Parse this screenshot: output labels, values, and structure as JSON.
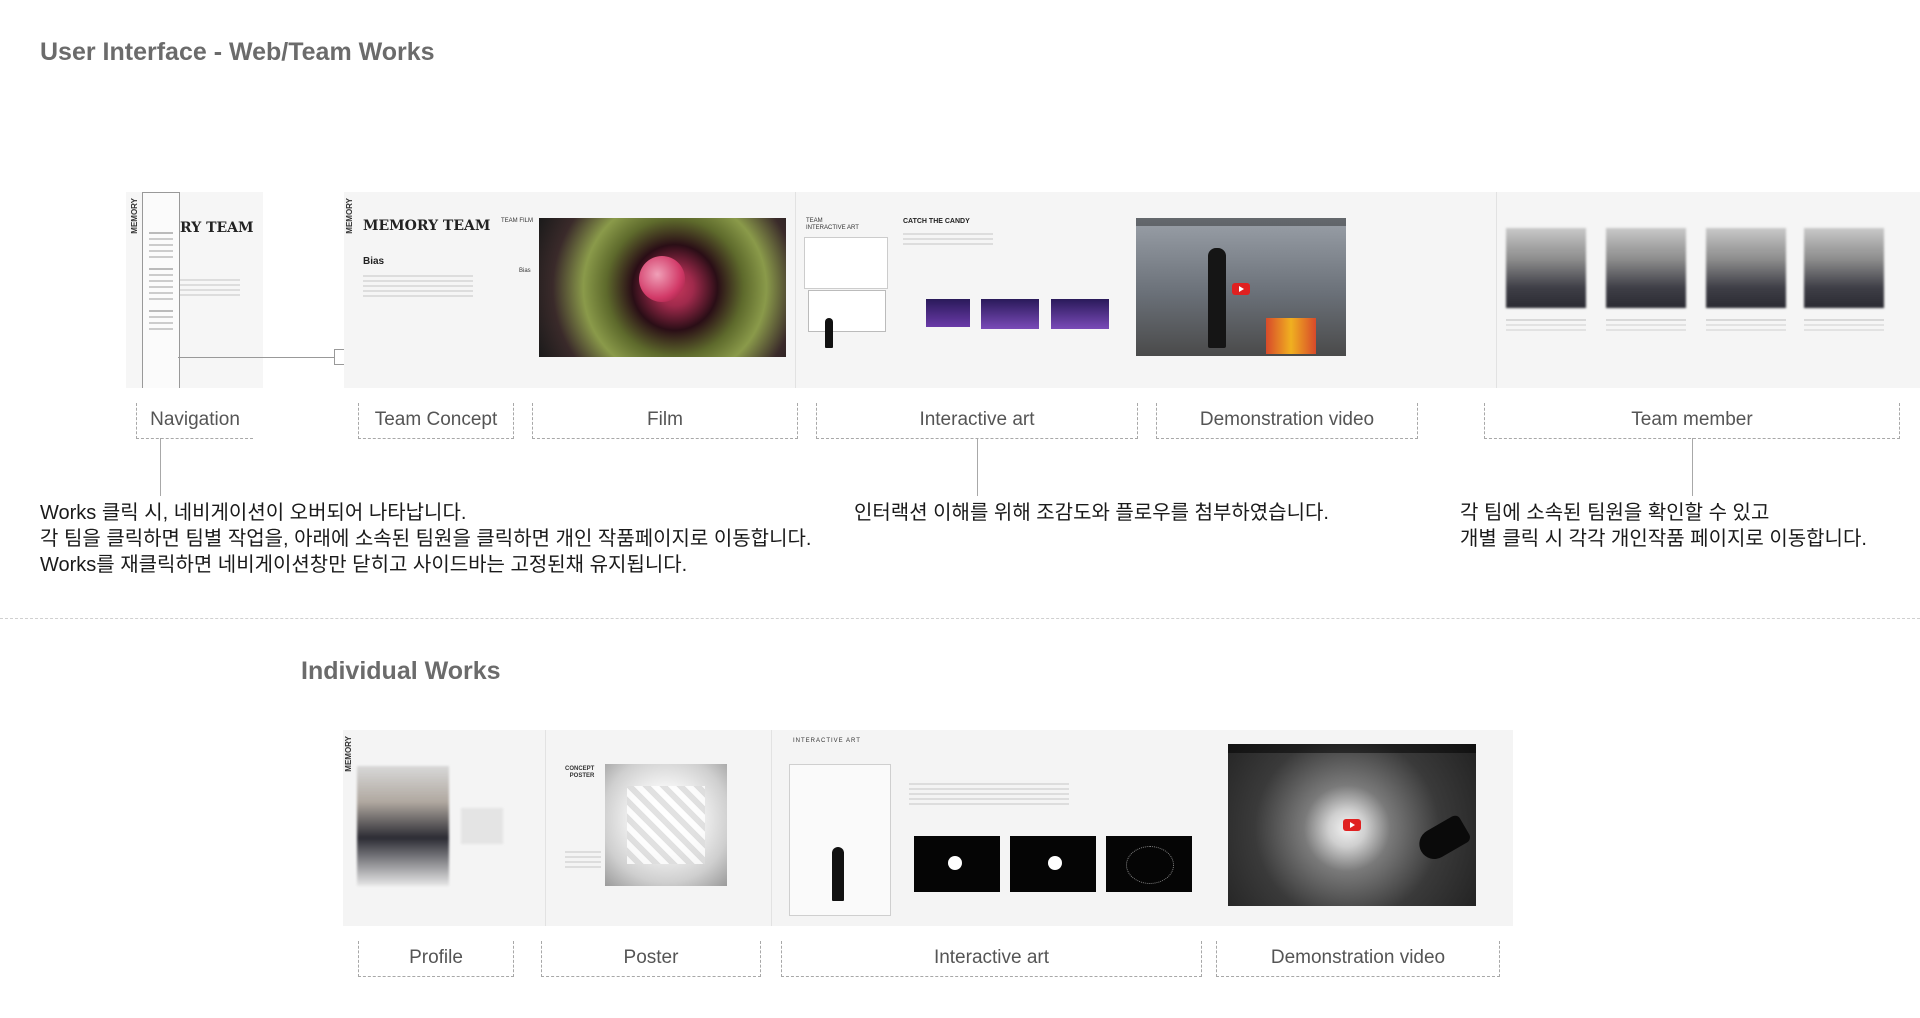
{
  "headings": {
    "team": "User Interface - Web/Team Works",
    "individual": "Individual Works"
  },
  "team_panels": {
    "team_name": "MEMORY TEAM",
    "team_name_partial": "RY TEAM",
    "team_film_label": "TEAM FILM",
    "film_title": "Bias",
    "film_title_small": "Bias",
    "interactive_label": "TEAM\nINTERACTIVE ART",
    "catch_title": "CATCH THE CANDY",
    "demo_video_label": "YouTube"
  },
  "team_captions": {
    "navigation": "Navigation",
    "team_concept": "Team Concept",
    "film": "Film",
    "interactive_art": "Interactive art",
    "demonstration_video": "Demonstration video",
    "team_member": "Team member"
  },
  "descriptions": {
    "navigation": [
      "Works 클릭 시, 네비게이션이 오버되어 나타납니다.",
      "각 팀을 클릭하면 팀별 작업을, 아래에 소속된 팀원을 클릭하면 개인 작품페이지로 이동합니다.",
      "Works를 재클릭하면 네비게이션창만 닫히고 사이드바는 고정된채 유지됩니다."
    ],
    "interactive": [
      "인터랙션 이해를 위해 조감도와 플로우를 첨부하였습니다."
    ],
    "team_member": [
      "각 팀에 소속된 팀원을 확인할 수 있고",
      "개별 클릭 시 각각 개인작품 페이지로 이동합니다."
    ]
  },
  "individual_panels": {
    "concept_poster_label": "CONCEPT\nPOSTER",
    "interactive_art_label": "INTERACTIVE ART"
  },
  "individual_captions": {
    "profile": "Profile",
    "poster": "Poster",
    "interactive_art": "Interactive art",
    "demonstration_video": "Demonstration video"
  },
  "colors": {
    "heading": "#6b6b6b",
    "caption_border": "#a8a8a8",
    "panel_bg": "#f4f4f4",
    "play_red": "#e02020"
  }
}
